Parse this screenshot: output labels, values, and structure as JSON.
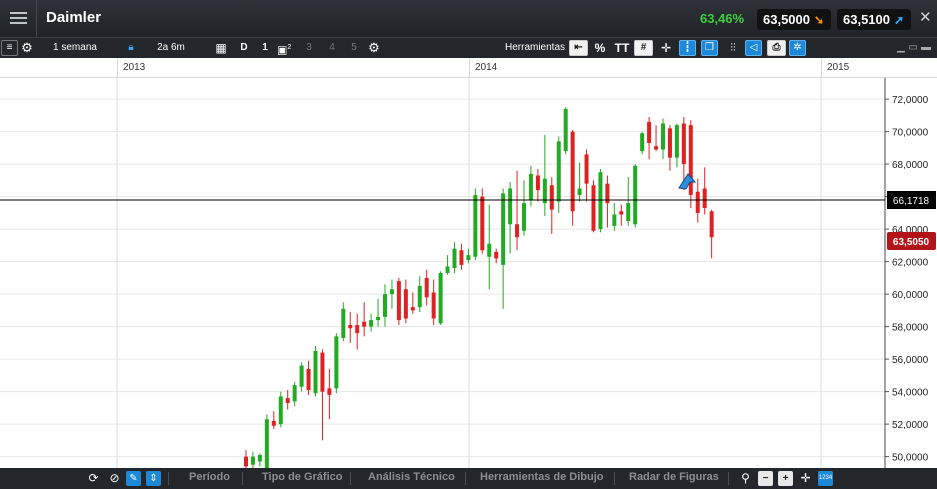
{
  "header": {
    "title": "Daimler",
    "change_pct": "63,46%",
    "sell_price": "63,5000",
    "buy_price": "63,5100",
    "close_label": "✕"
  },
  "toolbar": {
    "interval": "1 semana",
    "range": "2a 6m",
    "period_code": "D",
    "layout_options": [
      "1",
      "2",
      "3",
      "4",
      "5"
    ],
    "tools_label": "Herramientas",
    "percent_label": "%",
    "text_label": "TT"
  },
  "year_axis": [
    "2013",
    "2014",
    "2015"
  ],
  "bottom_bar": {
    "tabs": [
      "Período",
      "Tipo de Gráfico",
      "Análisis Técnico",
      "Herramientas de Dibujo",
      "Radar de Figuras"
    ],
    "zoom_label": "1234"
  },
  "colors": {
    "up": "#22aa22",
    "down": "#dd2222",
    "last_price_bg": "#b3141a",
    "crosshair_label_bg": "#000000"
  },
  "chart_data": {
    "type": "candlestick",
    "y_ticks": [
      "72,0000",
      "70,0000",
      "68,0000",
      "66,0000",
      "64,0000",
      "62,0000",
      "60,0000",
      "58,0000",
      "56,0000",
      "54,0000",
      "52,0000",
      "50,0000"
    ],
    "ylim": [
      49.3,
      73.3
    ],
    "crosshair_value": "66,1718",
    "last_price": "63,5050",
    "candles": [
      {
        "o": 50.0,
        "c": 49.4,
        "h": 50.4,
        "l": 49.2
      },
      {
        "o": 49.5,
        "c": 50.0,
        "h": 50.3,
        "l": 49.3
      },
      {
        "o": 49.7,
        "c": 50.1,
        "h": 50.2,
        "l": 49.4
      },
      {
        "o": 49.3,
        "c": 52.3,
        "h": 52.6,
        "l": 49.2
      },
      {
        "o": 52.2,
        "c": 51.9,
        "h": 52.8,
        "l": 51.7
      },
      {
        "o": 52.0,
        "c": 53.7,
        "h": 54.0,
        "l": 51.8
      },
      {
        "o": 53.6,
        "c": 53.3,
        "h": 54.1,
        "l": 52.9
      },
      {
        "o": 53.4,
        "c": 54.4,
        "h": 54.6,
        "l": 53.1
      },
      {
        "o": 54.3,
        "c": 55.6,
        "h": 55.8,
        "l": 54.0
      },
      {
        "o": 55.4,
        "c": 54.1,
        "h": 55.9,
        "l": 53.8
      },
      {
        "o": 53.9,
        "c": 56.5,
        "h": 56.8,
        "l": 53.7
      },
      {
        "o": 56.4,
        "c": 54.0,
        "h": 56.6,
        "l": 51.0
      },
      {
        "o": 54.2,
        "c": 53.8,
        "h": 55.4,
        "l": 52.3
      },
      {
        "o": 54.2,
        "c": 57.4,
        "h": 57.6,
        "l": 53.9
      },
      {
        "o": 57.3,
        "c": 59.1,
        "h": 59.5,
        "l": 57.1
      },
      {
        "o": 58.1,
        "c": 57.9,
        "h": 58.9,
        "l": 57.0
      },
      {
        "o": 58.1,
        "c": 57.6,
        "h": 58.8,
        "l": 56.6
      },
      {
        "o": 58.3,
        "c": 58.0,
        "h": 59.5,
        "l": 57.4
      },
      {
        "o": 58.0,
        "c": 58.4,
        "h": 58.8,
        "l": 57.7
      },
      {
        "o": 58.4,
        "c": 58.6,
        "h": 59.7,
        "l": 58.0
      },
      {
        "o": 58.6,
        "c": 60.0,
        "h": 60.6,
        "l": 58.0
      },
      {
        "o": 60.0,
        "c": 60.3,
        "h": 60.9,
        "l": 59.1
      },
      {
        "o": 60.8,
        "c": 58.4,
        "h": 61.0,
        "l": 58.1
      },
      {
        "o": 60.3,
        "c": 58.5,
        "h": 60.9,
        "l": 58.2
      },
      {
        "o": 59.2,
        "c": 59.0,
        "h": 60.1,
        "l": 58.8
      },
      {
        "o": 59.2,
        "c": 60.5,
        "h": 61.1,
        "l": 58.9
      },
      {
        "o": 61.0,
        "c": 59.8,
        "h": 61.5,
        "l": 59.3
      },
      {
        "o": 60.1,
        "c": 58.5,
        "h": 60.9,
        "l": 58.1
      },
      {
        "o": 58.2,
        "c": 61.3,
        "h": 61.4,
        "l": 58.1
      },
      {
        "o": 61.3,
        "c": 61.7,
        "h": 62.4,
        "l": 61.2
      },
      {
        "o": 61.6,
        "c": 62.8,
        "h": 63.2,
        "l": 61.3
      },
      {
        "o": 62.7,
        "c": 61.8,
        "h": 63.1,
        "l": 61.5
      },
      {
        "o": 62.1,
        "c": 62.4,
        "h": 62.8,
        "l": 61.9
      },
      {
        "o": 62.3,
        "c": 66.1,
        "h": 66.5,
        "l": 62.1
      },
      {
        "o": 66.0,
        "c": 62.7,
        "h": 66.5,
        "l": 62.5
      },
      {
        "o": 62.3,
        "c": 63.1,
        "h": 65.5,
        "l": 60.3
      },
      {
        "o": 62.6,
        "c": 62.2,
        "h": 62.8,
        "l": 61.9
      },
      {
        "o": 61.8,
        "c": 66.2,
        "h": 66.5,
        "l": 59.1
      },
      {
        "o": 64.3,
        "c": 66.5,
        "h": 66.9,
        "l": 62.5
      },
      {
        "o": 64.3,
        "c": 63.5,
        "h": 67.6,
        "l": 62.7
      },
      {
        "o": 63.9,
        "c": 65.6,
        "h": 67.0,
        "l": 63.6
      },
      {
        "o": 65.8,
        "c": 67.4,
        "h": 67.9,
        "l": 65.4
      },
      {
        "o": 67.3,
        "c": 66.4,
        "h": 67.7,
        "l": 65.7
      },
      {
        "o": 65.6,
        "c": 67.1,
        "h": 69.8,
        "l": 64.8
      },
      {
        "o": 66.7,
        "c": 65.2,
        "h": 67.2,
        "l": 63.7
      },
      {
        "o": 65.7,
        "c": 69.4,
        "h": 69.7,
        "l": 65.0
      },
      {
        "o": 68.8,
        "c": 71.4,
        "h": 71.5,
        "l": 68.6
      },
      {
        "o": 70.0,
        "c": 65.1,
        "h": 70.1,
        "l": 64.2
      },
      {
        "o": 66.1,
        "c": 66.5,
        "h": 68.1,
        "l": 65.7
      },
      {
        "o": 68.6,
        "c": 66.8,
        "h": 68.9,
        "l": 65.7
      },
      {
        "o": 66.7,
        "c": 63.9,
        "h": 67.0,
        "l": 63.8
      },
      {
        "o": 64.0,
        "c": 67.5,
        "h": 67.7,
        "l": 63.8
      },
      {
        "o": 66.8,
        "c": 65.6,
        "h": 67.3,
        "l": 64.1
      },
      {
        "o": 64.2,
        "c": 64.9,
        "h": 65.6,
        "l": 63.9
      },
      {
        "o": 65.1,
        "c": 64.9,
        "h": 65.5,
        "l": 64.2
      },
      {
        "o": 64.5,
        "c": 65.6,
        "h": 67.2,
        "l": 64.2
      },
      {
        "o": 64.3,
        "c": 67.9,
        "h": 68.0,
        "l": 64.1
      },
      {
        "o": 68.8,
        "c": 69.9,
        "h": 70.0,
        "l": 68.6
      },
      {
        "o": 70.6,
        "c": 69.3,
        "h": 70.9,
        "l": 68.3
      },
      {
        "o": 69.1,
        "c": 68.9,
        "h": 70.4,
        "l": 68.8
      },
      {
        "o": 68.9,
        "c": 70.5,
        "h": 70.8,
        "l": 68.3
      },
      {
        "o": 70.2,
        "c": 68.4,
        "h": 70.4,
        "l": 67.6
      },
      {
        "o": 68.4,
        "c": 70.4,
        "h": 70.5,
        "l": 67.8
      },
      {
        "o": 70.5,
        "c": 68.0,
        "h": 70.9,
        "l": 66.4
      },
      {
        "o": 70.4,
        "c": 66.1,
        "h": 70.7,
        "l": 65.3
      },
      {
        "o": 66.3,
        "c": 65.0,
        "h": 67.1,
        "l": 64.4
      },
      {
        "o": 66.5,
        "c": 65.3,
        "h": 67.8,
        "l": 64.9
      },
      {
        "o": 65.1,
        "c": 63.5,
        "h": 65.2,
        "l": 62.2
      }
    ]
  }
}
